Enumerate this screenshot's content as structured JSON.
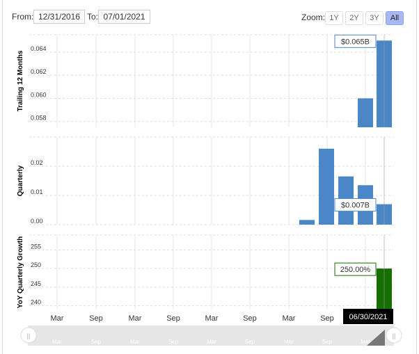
{
  "range": {
    "from_label": "From:",
    "from": "12/31/2016",
    "to_label": "To:",
    "to": "07/01/2021"
  },
  "zoom": {
    "label": "Zoom:",
    "buttons": [
      "1Y",
      "2Y",
      "3Y",
      "All"
    ],
    "active": "All"
  },
  "colors": {
    "blue": "#4a86c8",
    "green": "#157000"
  },
  "chart_data": [
    {
      "type": "bar",
      "ylabel": "Trailing 12 Months",
      "ylim": [
        0.0575,
        0.0655
      ],
      "yticks": [
        "0.058",
        "0.060",
        "0.062",
        "0.064"
      ],
      "ytick_values": [
        0.058,
        0.06,
        0.062,
        0.064
      ],
      "x": [
        "03/31/2021",
        "06/30/2021"
      ],
      "values": [
        0.06,
        0.065
      ],
      "tooltip": "$0.065B",
      "color": "#4a86c8"
    },
    {
      "type": "bar",
      "ylabel": "Quarterly",
      "ylim": [
        0,
        0.03
      ],
      "yticks": [
        "0.00",
        "0.01",
        "0.02"
      ],
      "ytick_values": [
        0,
        0.01,
        0.02
      ],
      "x": [
        "06/30/2020",
        "09/30/2020",
        "12/31/2020",
        "03/31/2021",
        "06/30/2021"
      ],
      "values": [
        0.0016,
        0.026,
        0.0165,
        0.0135,
        0.007
      ],
      "tooltip": "$0.007B",
      "color": "#4a86c8"
    },
    {
      "type": "bar",
      "ylabel": "YoY Quarterly Growth",
      "ylim": [
        239,
        259
      ],
      "yticks": [
        "240",
        "245",
        "250",
        "255"
      ],
      "ytick_values": [
        240,
        245,
        250,
        255
      ],
      "x": [
        "06/30/2021"
      ],
      "values": [
        250
      ],
      "tooltip": "250.00%",
      "color": "#157000"
    }
  ],
  "xaxis": {
    "ticks": [
      "Mar",
      "Sep",
      "Mar",
      "Sep",
      "Mar",
      "Sep",
      "Mar",
      "Sep"
    ],
    "hover_label": "06/30/2021"
  },
  "navigator": {
    "ticks": [
      "Mar",
      "Sep",
      "Mar",
      "Sep",
      "Mar",
      "Sep",
      "Mar",
      "Sep",
      "Mar"
    ]
  }
}
